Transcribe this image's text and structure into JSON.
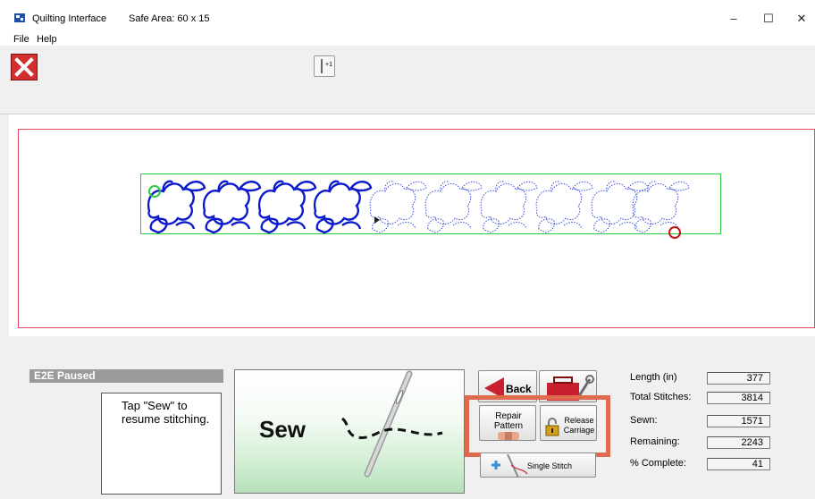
{
  "window": {
    "title": "Quilting Interface",
    "safe_area": "Safe Area: 60 x 15",
    "controls": {
      "minimize": "–",
      "maximize": "☐",
      "close": "✕"
    }
  },
  "menu": {
    "file": "File",
    "help": "Help"
  },
  "toolbar": {
    "needle_label": "+1"
  },
  "status": {
    "mode": "E2E Paused",
    "message": "Tap \"Sew\" to resume stitching."
  },
  "buttons": {
    "sew": "Sew",
    "back": "Back",
    "repair": "Repair Pattern",
    "release": "Release Carriage",
    "single_stitch": "Single Stitch"
  },
  "stats": {
    "length_label": "Length (in)",
    "length_value": "377",
    "total_label": "Total Stitches:",
    "total_value": "3814",
    "sewn_label": "Sewn:",
    "sewn_value": "1571",
    "remaining_label": "Remaining:",
    "remaining_value": "2243",
    "complete_label": "% Complete:",
    "complete_value": "41"
  },
  "colors": {
    "safe_border": "#e04a5a",
    "pattern_border": "#2ecc40",
    "sewn_stroke": "#0a1acc",
    "remaining_stroke": "#3b4fd6",
    "highlight": "#e06a4d",
    "status_bg": "#9a9a9a",
    "start_marker": "#2ecc40",
    "end_marker": "#cc1111"
  },
  "icons": {
    "app": "quilt-app-icon",
    "close": "close-x-icon",
    "needle": "needle-advance-icon",
    "back": "back-arrow-icon",
    "tools": "toolbox-icon",
    "repair": "bandage-icon",
    "release": "padlock-icon",
    "single": "needle-plus-icon"
  }
}
